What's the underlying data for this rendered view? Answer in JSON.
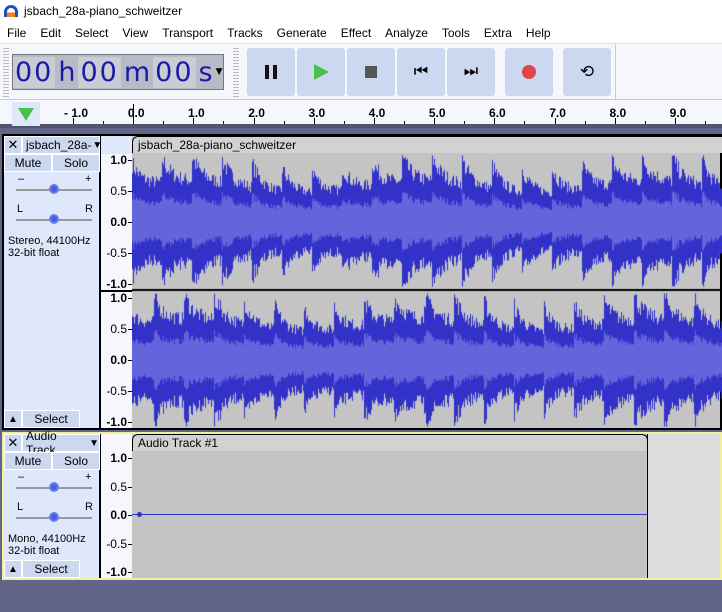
{
  "window": {
    "title": "jsbach_28a-piano_schweitzer"
  },
  "menu": [
    "File",
    "Edit",
    "Select",
    "View",
    "Transport",
    "Tracks",
    "Generate",
    "Effect",
    "Analyze",
    "Tools",
    "Extra",
    "Help"
  ],
  "time": {
    "hours": "00",
    "h": "h",
    "minutes": "00",
    "m": "m",
    "seconds": "00",
    "s": "s"
  },
  "transport": [
    "pause-icon",
    "play-icon",
    "stop-icon",
    "skip-start-icon",
    "skip-end-icon",
    "record-icon",
    "loop-icon"
  ],
  "colors": {
    "waveform": "#3232c8",
    "waveform_rms": "#6464dc",
    "play": "#4bbf4b",
    "record": "#e04848",
    "selected_border": "#f0f0a0"
  },
  "ruler": {
    "ticks": [
      "- 1.0",
      "0.0",
      "1.0",
      "2.0",
      "3.0",
      "4.0",
      "5.0",
      "6.0",
      "7.0",
      "8.0",
      "9.0"
    ]
  },
  "vruler": [
    "1.0",
    "0.5",
    "0.0",
    "-0.5",
    "-1.0"
  ],
  "tracks": [
    {
      "name": "jsbach_28a-",
      "clip": "jsbach_28a-piano_schweitzer",
      "mute": "Mute",
      "solo": "Solo",
      "gain_min": "–",
      "gain_max": "+",
      "pan_l": "L",
      "pan_r": "R",
      "info1": "Stereo, 44100Hz",
      "info2": "32-bit float",
      "select": "Select"
    },
    {
      "name": "Audio Track",
      "clip": "Audio Track #1",
      "mute": "Mute",
      "solo": "Solo",
      "gain_min": "–",
      "gain_max": "+",
      "pan_l": "L",
      "pan_r": "R",
      "info1": "Mono, 44100Hz",
      "info2": "32-bit float",
      "select": "Select"
    }
  ]
}
